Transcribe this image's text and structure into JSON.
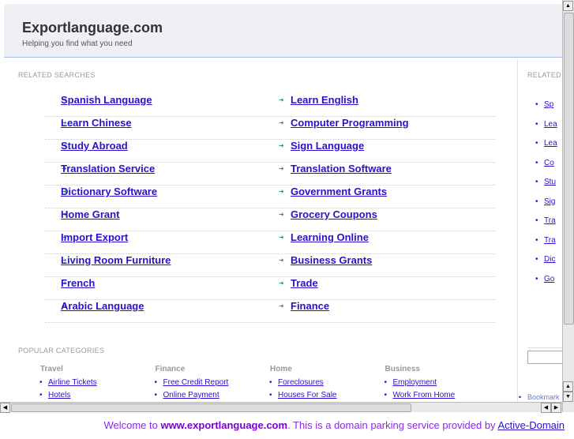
{
  "header": {
    "title": "Exportlanguage.com",
    "tagline": "Helping you find what you need"
  },
  "related": {
    "heading": "RELATED SEARCHES",
    "left": [
      "Spanish Language",
      "Learn Chinese",
      "Study Abroad",
      "Translation Service",
      "Dictionary Software",
      "Home Grant",
      "Import Export",
      "Living Room Furniture",
      "French",
      "Arabic Language"
    ],
    "right": [
      "Learn English",
      "Computer Programming",
      "Sign Language",
      "Translation Software",
      "Government Grants",
      "Grocery Coupons",
      "Learning Online",
      "Business Grants",
      "Trade",
      "Finance"
    ]
  },
  "popular": {
    "heading": "POPULAR CATEGORIES",
    "categories": [
      {
        "name": "Travel",
        "links": [
          "Airline Tickets",
          "Hotels"
        ]
      },
      {
        "name": "Finance",
        "links": [
          "Free Credit Report",
          "Online Payment"
        ]
      },
      {
        "name": "Home",
        "links": [
          "Foreclosures",
          "Houses For Sale"
        ]
      },
      {
        "name": "Business",
        "links": [
          "Employment",
          "Work From Home"
        ]
      }
    ]
  },
  "sidebar": {
    "heading": "RELATED",
    "links": [
      "Sp",
      "Lea",
      "Lea",
      "Co",
      "Stu",
      "Sig",
      "Tra",
      "Tra",
      "Dic",
      "Go"
    ],
    "bookmark": "Bookmark"
  },
  "banner": {
    "prefix": "Welcome to ",
    "domain": "www.exportlanguage.com",
    "middle": ". This is a domain parking service provided by ",
    "provider": "Active-Domain"
  }
}
